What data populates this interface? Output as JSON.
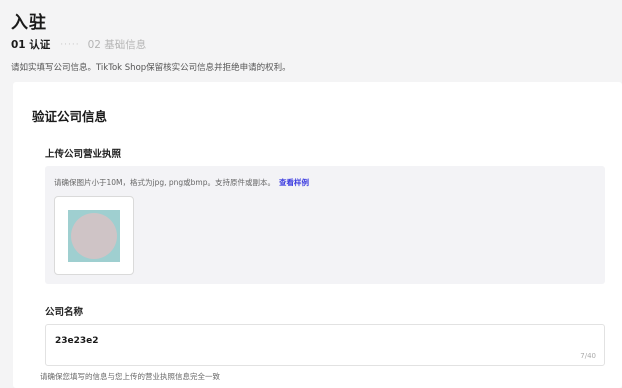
{
  "page": {
    "title": "入驻",
    "notice": "请如实填写公司信息。TikTok Shop保留核实公司信息并拒绝申请的权利。"
  },
  "steps": [
    {
      "label": "01 认证",
      "state": "active"
    },
    {
      "separator": "·····"
    },
    {
      "label": "02 基础信息",
      "state": "inactive"
    }
  ],
  "section": {
    "title": "验证公司信息",
    "upload": {
      "label": "上传公司营业执照",
      "hint": "请确保图片小于10M，格式为jpg, png或bmp。支持原件或副本。",
      "example_link": "查看样例"
    },
    "company_name": {
      "label": "公司名称",
      "value": "23e23e2",
      "char_count": "7/40",
      "hint": "请确保您填写的信息与您上传的营业执照信息完全一致"
    }
  }
}
